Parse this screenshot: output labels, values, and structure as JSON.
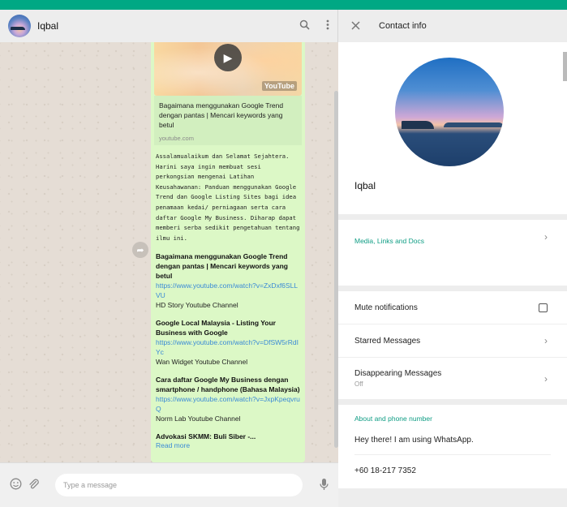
{
  "chat": {
    "contact_name": "Iqbal",
    "link_preview": {
      "title": "Bagaimana menggunakan Google Trend dengan pantas | Mencari keywords yang betul",
      "domain": "youtube.com",
      "thumb_badge": "YouTube"
    },
    "message_text": "Assalamualaikum dan Selamat Sejahtera. Harini saya ingin membuat sesi perkongsian mengenai Latihan Keusahawanan: Panduan menggunakan Google Trend dan Google Listing Sites bagi idea penamaan kedai/ perniagaan serta cara daftar Google My Business. Diharap dapat memberi serba sedikit pengetahuan tentang ilmu ini.",
    "entries": [
      {
        "title": "Bagaimana menggunakan Google Trend dengan pantas | Mencari keywords yang betul",
        "link": "https://www.youtube.com/watch?v=ZxDxf6SLLVU",
        "channel": "HD Story Youtube Channel"
      },
      {
        "title": "Google Local Malaysia - Listing Your Business with Google",
        "link": "https://www.youtube.com/watch?v=DfSW5rRdIYc",
        "channel": "Wan Widget Youtube Channel"
      },
      {
        "title": "Cara daftar Google My Business dengan smartphone / handphone (Bahasa Malaysia)",
        "link": "https://www.youtube.com/watch?v=JxpKpeqvruQ",
        "channel": "Norm Lab Youtube Channel"
      },
      {
        "title": "Advokasi SKMM: Buli Siber -..."
      }
    ],
    "read_more": "Read more",
    "input_placeholder": "Type a message"
  },
  "contact_info": {
    "title": "Contact info",
    "name": "Iqbal",
    "media_label": "Media, Links and Docs",
    "mute_label": "Mute notifications",
    "starred_label": "Starred Messages",
    "disappearing_label": "Disappearing Messages",
    "disappearing_value": "Off",
    "about_label": "About and phone number",
    "about_status": "Hey there! I am using WhatsApp.",
    "phone": "+60 18-217 7352"
  }
}
